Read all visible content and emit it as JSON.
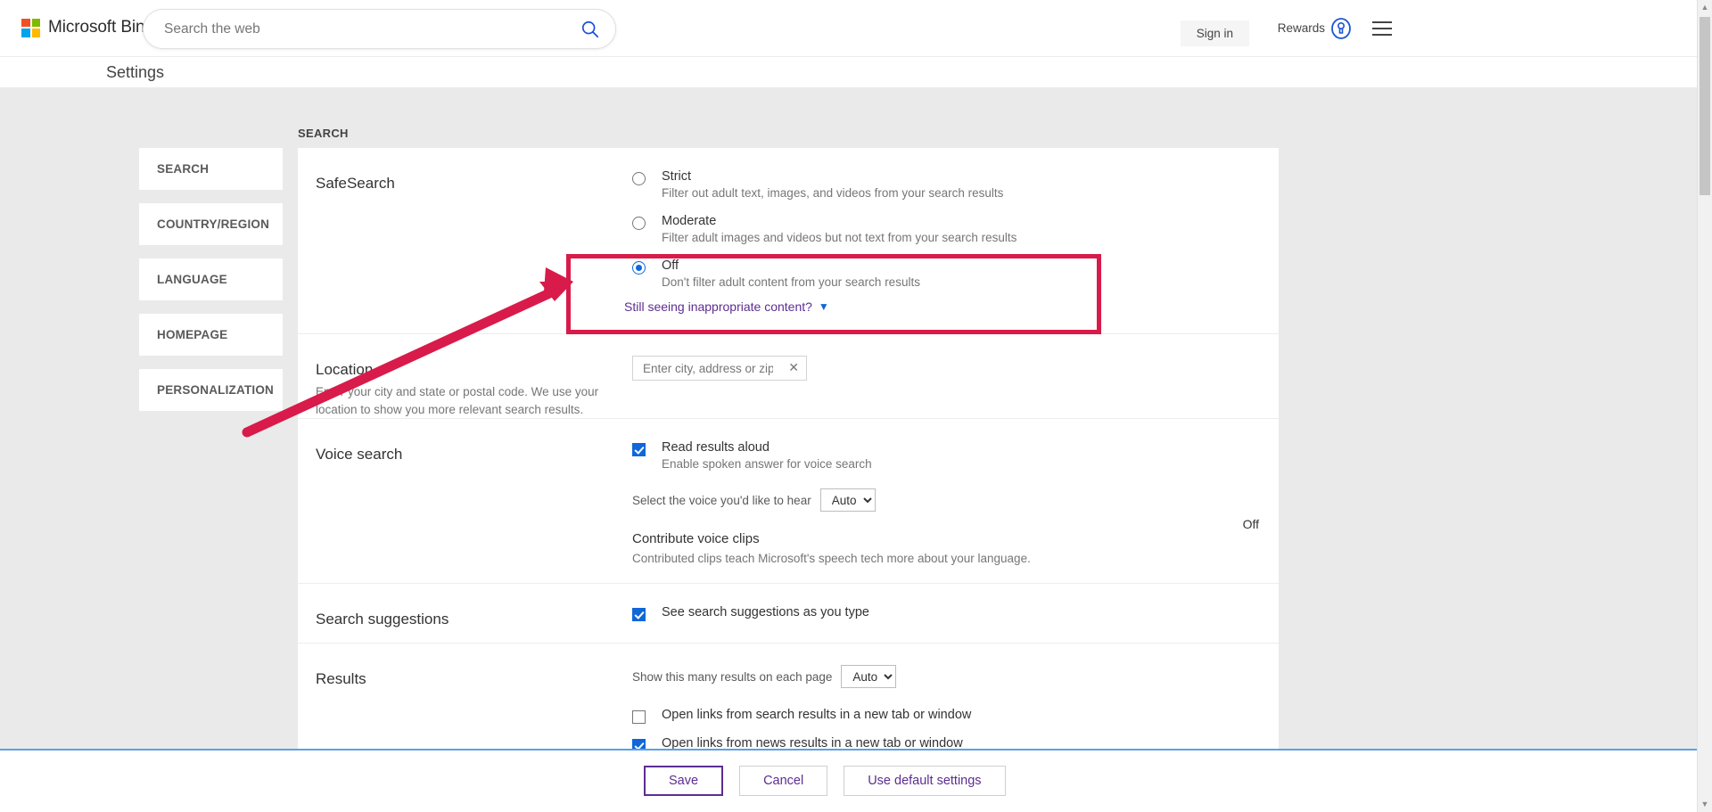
{
  "header": {
    "brand": "Microsoft Bing",
    "logo_colors": [
      "#f25022",
      "#7fba00",
      "#00a4ef",
      "#ffb900"
    ],
    "search_placeholder": "Search the web",
    "search_value": "",
    "search_icon": "search-icon",
    "sign_in": "Sign in",
    "rewards": "Rewards",
    "rewards_icon": "rewards-medal-icon",
    "menu_icon": "hamburger-menu-icon"
  },
  "page_title": "Settings",
  "sidebar": {
    "items": [
      {
        "label": "SEARCH",
        "active": true
      },
      {
        "label": "COUNTRY/REGION",
        "active": false
      },
      {
        "label": "LANGUAGE",
        "active": false
      },
      {
        "label": "HOMEPAGE",
        "active": false
      },
      {
        "label": "PERSONALIZATION",
        "active": false
      }
    ]
  },
  "main": {
    "section_label": "SEARCH",
    "safesearch": {
      "title": "SafeSearch",
      "options": [
        {
          "label": "Strict",
          "desc": "Filter out adult text, images, and videos from your search results",
          "checked": false
        },
        {
          "label": "Moderate",
          "desc": "Filter adult images and videos but not text from your search results",
          "checked": false
        },
        {
          "label": "Off",
          "desc": "Don't filter adult content from your search results",
          "checked": true
        }
      ],
      "link": "Still seeing inappropriate content?",
      "link_chevron": "chevron-down-icon"
    },
    "location": {
      "title": "Location",
      "desc": "Enter your city and state or postal code. We use your location to show you more relevant search results.",
      "input_placeholder": "Enter city, address or zip code",
      "input_value": "",
      "clear_icon": "close-x-icon"
    },
    "voice_search": {
      "title": "Voice search",
      "read_aloud_label": "Read results aloud",
      "read_aloud_desc": "Enable spoken answer for voice search",
      "read_aloud_checked": true,
      "voice_select_label": "Select the voice you'd like to hear",
      "voice_select_value": "Auto",
      "voice_select_options": [
        "Auto"
      ],
      "contribute_title": "Contribute voice clips",
      "contribute_desc": "Contributed clips teach Microsoft's speech tech more about your language.",
      "contribute_state": "Off"
    },
    "search_suggestions": {
      "title": "Search suggestions",
      "label": "See search suggestions as you type",
      "checked": true
    },
    "results": {
      "title": "Results",
      "count_label": "Show this many results on each page",
      "count_value": "Auto",
      "count_options": [
        "Auto"
      ],
      "checkboxes": [
        {
          "label": "Open links from search results in a new tab or window",
          "checked": false
        },
        {
          "label": "Open links from news results in a new tab or window",
          "checked": true
        }
      ]
    }
  },
  "footer": {
    "save": "Save",
    "cancel": "Cancel",
    "defaults": "Use default settings"
  },
  "annotation": {
    "highlight_color": "#d81b4a",
    "target": "SafeSearch Off option"
  }
}
